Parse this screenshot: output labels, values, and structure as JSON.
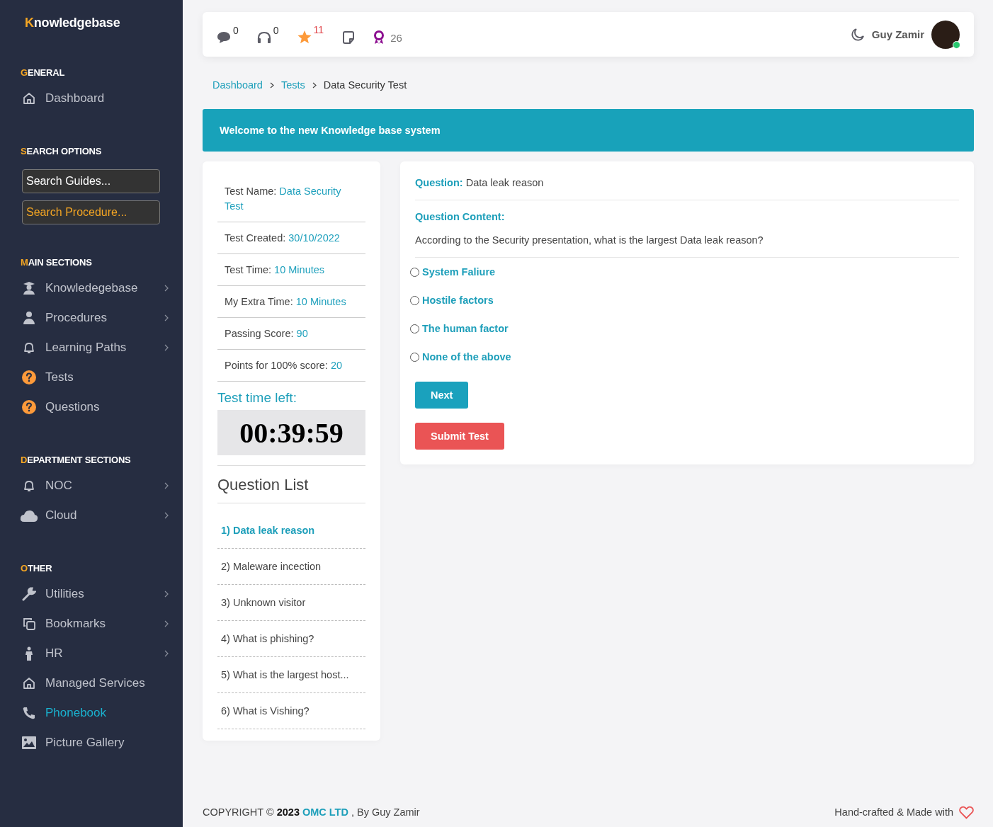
{
  "sidebar": {
    "brand": "Knowledgebase",
    "sections": [
      {
        "title": "GENERAL",
        "items": [
          {
            "label": "Dashboard",
            "has_submenu": false,
            "selected": false
          }
        ]
      },
      {
        "title": "SEARCH OPTIONS",
        "fields": [
          {
            "placeholder": "Search Guides...",
            "kind": "guides"
          },
          {
            "placeholder": "Search Procedure...",
            "kind": "procedure"
          }
        ]
      },
      {
        "title": "MAIN SECTIONS",
        "items": [
          {
            "label": "Knowledegebase",
            "has_submenu": true,
            "selected": false
          },
          {
            "label": "Procedures",
            "has_submenu": true,
            "selected": false
          },
          {
            "label": "Learning Paths",
            "has_submenu": true,
            "selected": false
          },
          {
            "label": "Tests",
            "has_submenu": false,
            "selected": false
          },
          {
            "label": "Questions",
            "has_submenu": false,
            "selected": false
          }
        ]
      },
      {
        "title": "DEPARTMENT SECTIONS",
        "items": [
          {
            "label": "NOC",
            "has_submenu": true,
            "selected": false
          },
          {
            "label": "Cloud",
            "has_submenu": true,
            "selected": false
          }
        ]
      },
      {
        "title": "OTHER",
        "items": [
          {
            "label": "Utilities",
            "has_submenu": true,
            "selected": false
          },
          {
            "label": "Bookmarks",
            "has_submenu": true,
            "selected": false
          },
          {
            "label": "HR",
            "has_submenu": true,
            "selected": false
          },
          {
            "label": "Managed Services",
            "has_submenu": false,
            "selected": false
          },
          {
            "label": "Phonebook",
            "has_submenu": false,
            "selected": true
          },
          {
            "label": "Picture Gallery",
            "has_submenu": false,
            "selected": false
          }
        ]
      }
    ]
  },
  "topbar": {
    "counters": [
      {
        "count": "0",
        "kind": "superscript"
      },
      {
        "count": "0",
        "kind": "superscript"
      },
      {
        "count": "11",
        "kind": "alert"
      },
      {
        "kind": "none"
      },
      {
        "count": "26",
        "kind": "inline"
      }
    ],
    "user": {
      "name": "Guy Zamir",
      "online": true
    }
  },
  "breadcrumb": [
    {
      "label": "Dashboard",
      "current": false
    },
    {
      "label": "Tests",
      "current": false
    },
    {
      "label": "Data Security Test",
      "current": true
    }
  ],
  "banner": "Welcome to the new Knowledge base system",
  "test_info": {
    "details": [
      {
        "label": "Test Name:",
        "value": "Data Security Test"
      },
      {
        "label": "Test Created:",
        "value": "30/10/2022"
      },
      {
        "label": "Test Time:",
        "value": "10 Minutes"
      },
      {
        "label": "My Extra Time:",
        "value": "10 Minutes"
      },
      {
        "label": "Passing Score:",
        "value": "90"
      },
      {
        "label": "Points for 100% score:",
        "value": "20"
      }
    ],
    "timer_heading": "Test time left:",
    "timer": "00:39:59",
    "list_title": "Question List",
    "questions": [
      {
        "label": "1) Data leak reason",
        "selected": true
      },
      {
        "label": "2) Maleware incection",
        "selected": false
      },
      {
        "label": "3) Unknown visitor",
        "selected": false
      },
      {
        "label": "4) What is phishing?",
        "selected": false
      },
      {
        "label": "5) What is the largest host...",
        "selected": false
      },
      {
        "label": "6) What is Vishing?",
        "selected": false
      }
    ]
  },
  "question": {
    "question_label": "Question:",
    "question_text": "Data leak reason",
    "content_label": "Question Content:",
    "content_text": "According to the Security presentation, what is the largest Data leak reason?",
    "options": [
      {
        "label": "System Faliure",
        "selected": false
      },
      {
        "label": "Hostile factors",
        "selected": false
      },
      {
        "label": "The human factor",
        "selected": false
      },
      {
        "label": "None of the above",
        "selected": false
      }
    ],
    "buttons": [
      {
        "label": "Next",
        "kind": "primary"
      },
      {
        "label": "Submit Test",
        "kind": "danger"
      }
    ]
  },
  "footer": {
    "copyright": "COPYRIGHT © **2023**",
    "company": "OMC LTD",
    "author": ", By Guy Zamir",
    "credit": "Hand-crafted & Made with"
  }
}
